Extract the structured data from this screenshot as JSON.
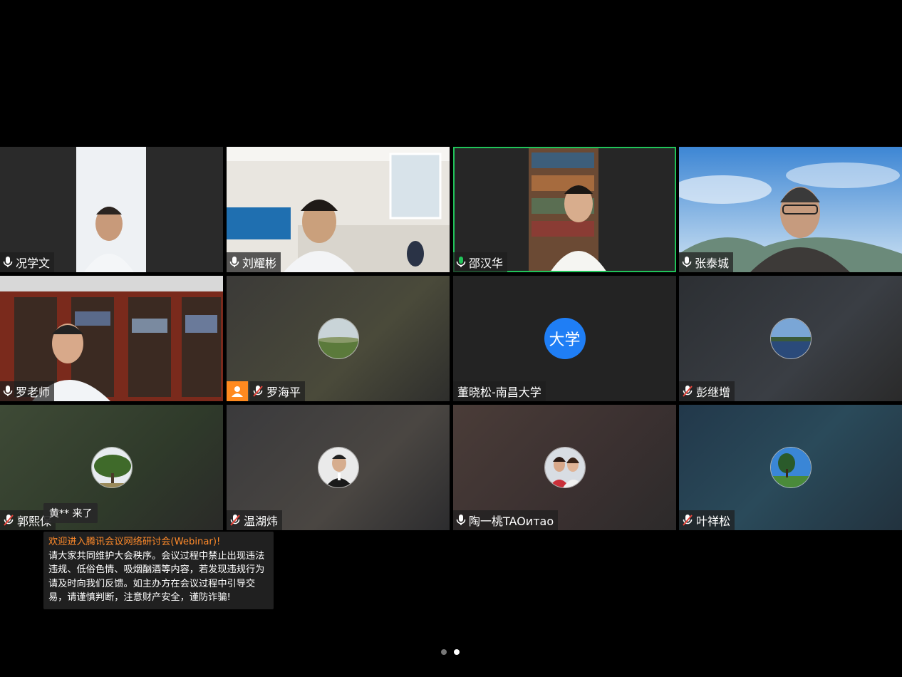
{
  "participants": [
    {
      "name": "况学文",
      "mic": "on"
    },
    {
      "name": "刘耀彬",
      "mic": "on"
    },
    {
      "name": "邵汉华",
      "mic": "speaking"
    },
    {
      "name": "张泰城",
      "mic": "on"
    },
    {
      "name": "罗老师",
      "mic": "on"
    },
    {
      "name": "罗海平",
      "mic": "muted"
    },
    {
      "name": "董晓松-南昌大学",
      "avatar_text": "大学"
    },
    {
      "name": "彭继增",
      "mic": "muted"
    },
    {
      "name": "郭熙保",
      "mic": "muted"
    },
    {
      "name": "温湖炜",
      "mic": "muted"
    },
    {
      "name": "陶一桃TAOитао",
      "mic": "on"
    },
    {
      "name": "叶祥松",
      "mic": "muted"
    }
  ],
  "toast": {
    "text": "黄** 来了"
  },
  "notice": {
    "title": "欢迎进入腾讯会议网络研讨会(Webinar)!",
    "body": "请大家共同维护大会秩序。会议过程中禁止出现违法违规、低俗色情、吸烟酗酒等内容，若发现违规行为请及时向我们反馈。如主办方在会议过程中引导交易，请谨慎判断，注意财产安全，谨防诈骗!"
  },
  "pagination": {
    "current": 2,
    "total": 2
  },
  "colors": {
    "active_speaker": "#21c45a",
    "notice_title": "#ff8a2a",
    "text_avatar": "#1f7ef5",
    "host_badge": "#ff8a1f"
  }
}
